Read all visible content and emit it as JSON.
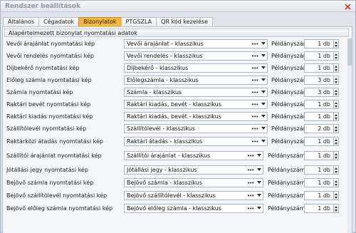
{
  "window": {
    "title": "Rendszer beállítások"
  },
  "tabs": [
    {
      "label": "Általános",
      "active": false
    },
    {
      "label": "Cégadatok",
      "active": false
    },
    {
      "label": "Bizonylatok",
      "active": true
    },
    {
      "label": "PTGSZLA",
      "active": false
    },
    {
      "label": "QR kód kezelése",
      "active": false
    }
  ],
  "group": {
    "title": "Alapértelmezett bizonylat nyomtatási adatok"
  },
  "copies_label": "Példányszám",
  "rows": [
    {
      "label": "Vevői árajánlat nyomtatási kép",
      "template": "Vevői árajánlat - klasszikus",
      "copies": "1 db"
    },
    {
      "label": "Vevői rendelés nyomtatási kép",
      "template": "Vevői rendelés - klasszikus",
      "copies": "1 db"
    },
    {
      "label": "Díjbekérő nyomtatási kép",
      "template": "Díjbekérő - klasszikus",
      "copies": "1 db"
    },
    {
      "label": "Előleg számla nyomtatási kép",
      "template": "Előlegszámla - klasszikus",
      "copies": "3 db"
    },
    {
      "label": "Számla nyomtatási kép",
      "template": "Számla - klasszikus",
      "copies": "3 db"
    },
    {
      "label": "Raktári bevét nyomtatási kép",
      "template": "Raktári kiadás, bevét - klasszikus",
      "copies": "1 db"
    },
    {
      "label": "Raktári kiadás nyomtatási kép",
      "template": "Raktári kiadás, bevét - klasszikus",
      "copies": "1 db"
    },
    {
      "label": "Szállítólevél nyomtatási kép",
      "template": "Szállítólevél - klasszikus",
      "copies": "2 db"
    },
    {
      "label": "Raktárközi átadás nyomtatási kép",
      "template": "Raktári átadás - klasszikus",
      "copies": "1 db"
    },
    {
      "label": "Szállítói árajánlat nyomtatási kép",
      "template": "Szállítói árajánlat - klasszikus",
      "copies": "1 db"
    },
    {
      "label": "Jótállási jegy nyomtatási kép",
      "template": "Jótállási jegy - klasszikus",
      "copies": "1 db"
    },
    {
      "label": "Bejövő számla nyomtatási kép",
      "template": "Bejövő számla - klasszikus",
      "copies": "1 db"
    },
    {
      "label": "Bejövő szállítólevél nyomtatási kép",
      "template": "Bejövő szállítólevél - klasszikus",
      "copies": "1 db"
    },
    {
      "label": "Bejövő előleg számla nyomtatási kép",
      "template": "Bejövő előleg számla - klasszikus",
      "copies": "1 db"
    }
  ],
  "icons": {
    "close": "close-icon",
    "dropdown": "chevron-down-icon",
    "ellipsis": "ellipsis-icon",
    "spinner": "spinner-arrows-icon"
  },
  "colors": {
    "active_tab": "#f6b83a",
    "title_text": "#8a96a8",
    "close_icon": "#c4452b"
  }
}
